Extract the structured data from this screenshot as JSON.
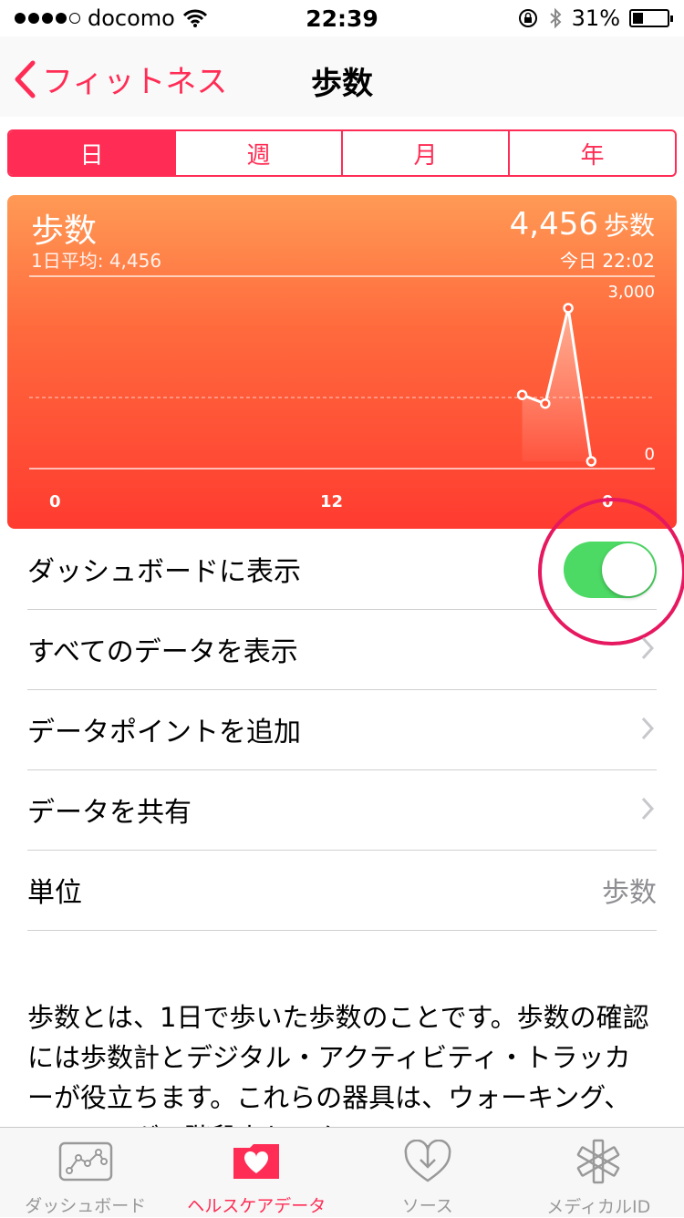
{
  "status": {
    "carrier": "docomo",
    "time": "22:39",
    "battery": "31%"
  },
  "nav": {
    "back_label": "フィットネス",
    "title": "歩数"
  },
  "segments": [
    "日",
    "週",
    "月",
    "年"
  ],
  "card": {
    "title": "歩数",
    "average": "1日平均: 4,456",
    "total_value": "4,456",
    "total_unit": "歩数",
    "date": "今日 22:02"
  },
  "chart_data": {
    "type": "line",
    "ylim": [
      0,
      3000
    ],
    "yticks": [
      "3,000",
      "0"
    ],
    "xticks": [
      "0",
      "12",
      "0"
    ],
    "points": [
      {
        "x": 20.3,
        "y": 1300
      },
      {
        "x": 21.3,
        "y": 1130
      },
      {
        "x": 22.3,
        "y": 3000
      },
      {
        "x": 23.3,
        "y": 0
      }
    ]
  },
  "list": {
    "dashboard": "ダッシュボードに表示",
    "all_data": "すべてのデータを表示",
    "add_point": "データポイントを追加",
    "share": "データを共有",
    "unit_label": "単位",
    "unit_value": "歩数"
  },
  "toggle_on": true,
  "description": "歩数とは、1日で歩いた歩数のことです。歩数の確認には歩数計とデジタル・アクティビティ・トラッカーが役立ちます。これらの器具は、ウォーキング、ランニング、階段上り、ク",
  "tabs": [
    {
      "label": "ダッシュボード",
      "icon": "dashboard-icon"
    },
    {
      "label": "ヘルスケアデータ",
      "icon": "health-data-icon"
    },
    {
      "label": "ソース",
      "icon": "sources-icon"
    },
    {
      "label": "メディカルID",
      "icon": "medical-id-icon"
    }
  ],
  "colors": {
    "accent": "#ff2d55",
    "toggle": "#4cd964"
  }
}
